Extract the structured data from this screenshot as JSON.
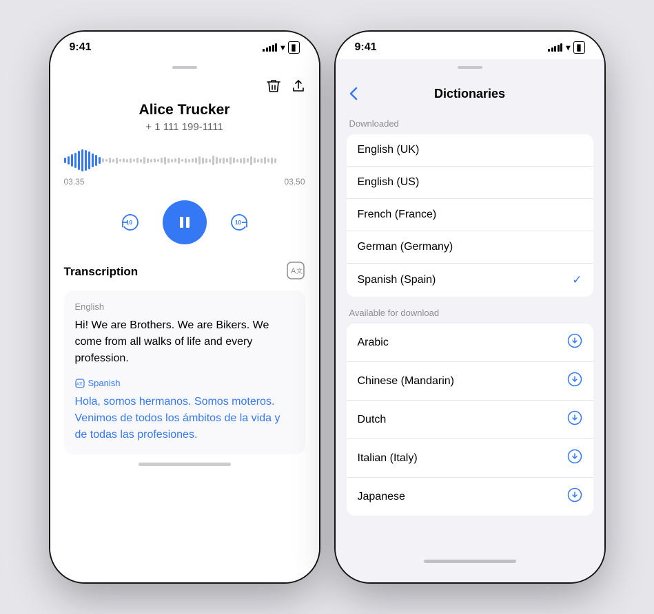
{
  "phone1": {
    "status": {
      "time": "9:41",
      "signal": [
        2,
        4,
        6,
        9,
        11
      ],
      "wifi": "wifi",
      "battery": "battery"
    },
    "drag_handle": true,
    "contact": {
      "name": "Alice Trucker",
      "phone": "+ 1 111 199-1111"
    },
    "waveform": {
      "time_start": "03.35",
      "time_end": "03.50"
    },
    "controls": {
      "rewind_label": "⟲10",
      "pause_label": "⏸",
      "forward_label": "⟳10"
    },
    "transcription": {
      "title": "Transcription",
      "original_lang": "English",
      "original_text": "Hi! We are Brothers. We are Bikers. We come from all walks of life and every profession.",
      "translated_lang": "Spanish",
      "translated_text": "Hola, somos hermanos. Somos moteros. Venimos de todos los ámbitos de la vida y de todas las profesiones."
    },
    "toolbar": {
      "delete_icon": "trash",
      "share_icon": "share"
    }
  },
  "phone2": {
    "status": {
      "time": "9:41"
    },
    "nav": {
      "back_label": "‹",
      "title": "Dictionaries"
    },
    "downloaded_section": {
      "label": "Downloaded",
      "items": [
        {
          "id": "en-uk",
          "text": "English (UK)",
          "selected": false
        },
        {
          "id": "en-us",
          "text": "English (US)",
          "selected": false
        },
        {
          "id": "fr-fr",
          "text": "French (France)",
          "selected": false
        },
        {
          "id": "de-de",
          "text": "German (Germany)",
          "selected": false
        },
        {
          "id": "es-es",
          "text": "Spanish (Spain)",
          "selected": true
        }
      ]
    },
    "available_section": {
      "label": "Available for download",
      "items": [
        {
          "id": "ar",
          "text": "Arabic"
        },
        {
          "id": "zh",
          "text": "Chinese (Mandarin)"
        },
        {
          "id": "nl",
          "text": "Dutch"
        },
        {
          "id": "it",
          "text": "Italian (Italy)"
        },
        {
          "id": "ja",
          "text": "Japanese"
        }
      ]
    }
  }
}
